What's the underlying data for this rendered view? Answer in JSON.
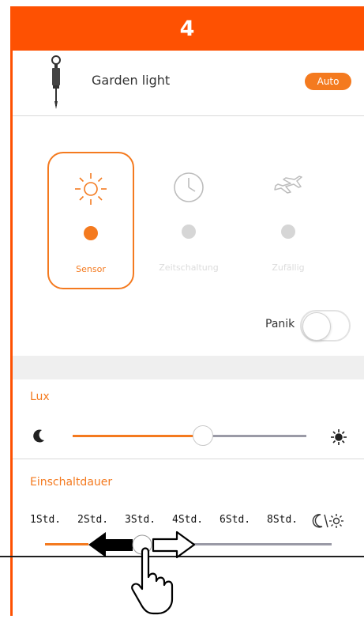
{
  "step": {
    "number": "4"
  },
  "device": {
    "name": "Garden light",
    "mode_badge": "Auto"
  },
  "modes": [
    {
      "label": "Sensor",
      "icon": "sun-icon",
      "selected": true
    },
    {
      "label": "Zeitschaltung",
      "icon": "clock-icon",
      "selected": false
    },
    {
      "label": "Zufällig",
      "icon": "airplane-icon",
      "selected": false
    }
  ],
  "panic": {
    "label": "Panik",
    "enabled": false
  },
  "lux": {
    "title": "Lux",
    "value_fraction": 0.56,
    "min_icon": "moon-icon",
    "max_icon": "sun-icon"
  },
  "duration": {
    "title": "Einschaltdauer",
    "options": [
      "1Std.",
      "2Std.",
      "3Std.",
      "4Std.",
      "6Std.",
      "8Std."
    ],
    "last_option_icon": "night-day-icon"
  },
  "colors": {
    "header": "#fe5102",
    "accent": "#f47a1f",
    "track_gray": "#9a9aa6"
  }
}
